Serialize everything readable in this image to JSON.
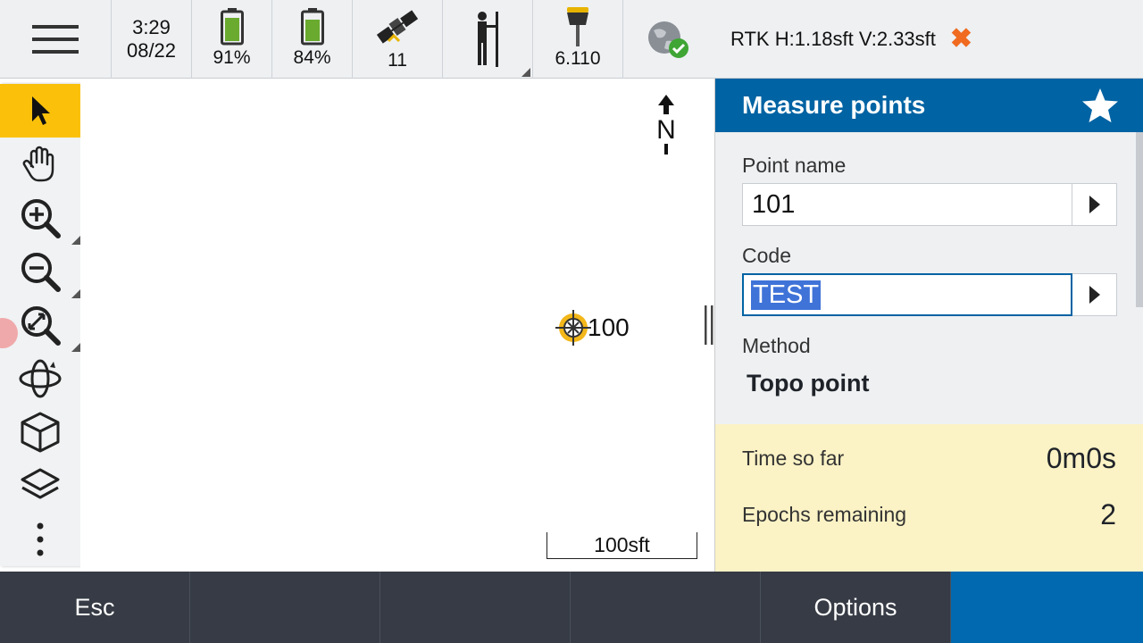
{
  "status_bar": {
    "time": "3:29",
    "date": "08/22",
    "battery1": "91%",
    "battery2": "84%",
    "satellites": "11",
    "antenna_height": "6.110",
    "rtk_status": "RTK H:1.18sft V:2.33sft"
  },
  "map": {
    "north_label": "N",
    "point_label": "100",
    "scale_label": "100sft"
  },
  "panel": {
    "title": "Measure points",
    "point_name_label": "Point name",
    "point_name_value": "101",
    "code_label": "Code",
    "code_value": "TEST",
    "method_label": "Method",
    "method_value": "Topo point",
    "time_label": "Time so far",
    "time_value": "0m0s",
    "epochs_label": "Epochs remaining",
    "epochs_value": "2"
  },
  "bottom_bar": {
    "esc": "Esc",
    "options": "Options"
  },
  "colors": {
    "header_blue": "#0063a3",
    "active_tool": "#fbc10a",
    "status_yellow": "#fbf2c5",
    "bottom_bar": "#363b45",
    "close_orange": "#f06a20"
  }
}
